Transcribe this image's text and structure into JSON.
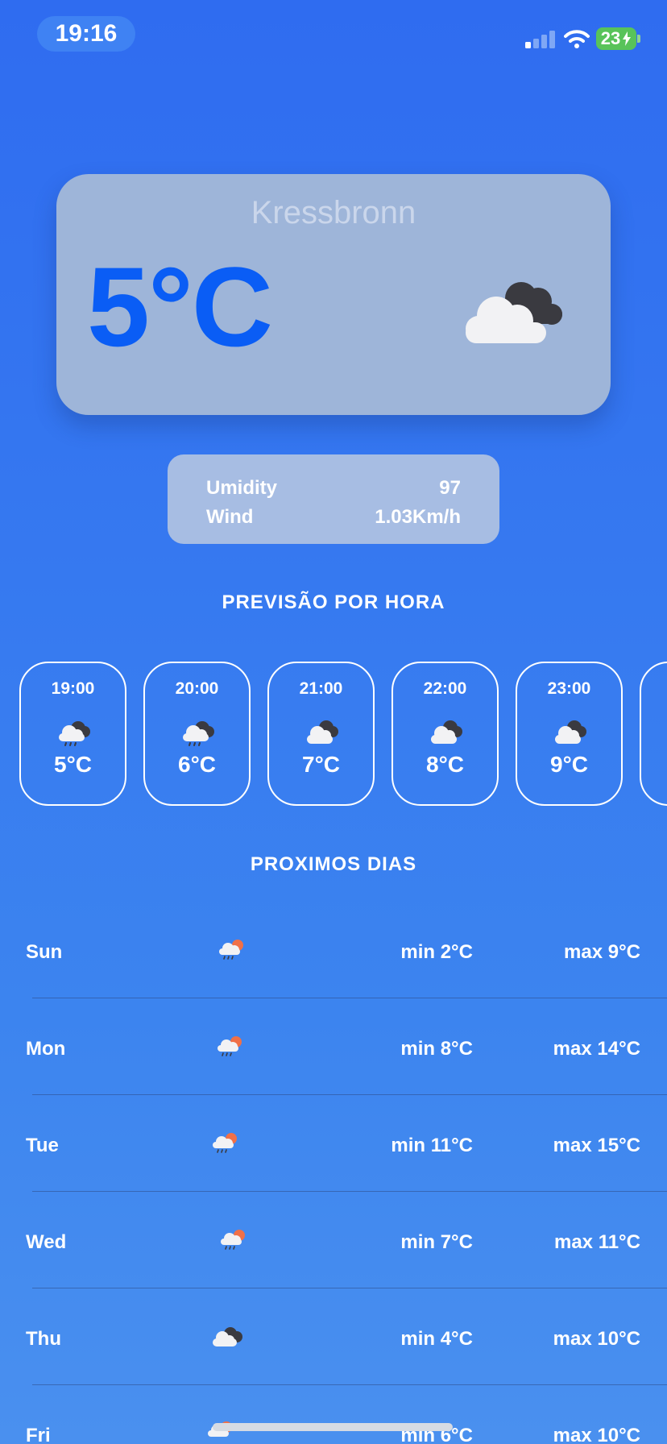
{
  "status_bar": {
    "time": "19:16",
    "battery": "23",
    "icons": [
      "signal-icon",
      "wifi-icon",
      "battery-charging-icon"
    ]
  },
  "current": {
    "city": "Kressbronn",
    "temperature": "5°C",
    "icon": "cloudy-icon"
  },
  "details": {
    "humidity_label": "Umidity",
    "humidity_value": "97",
    "wind_label": "Wind",
    "wind_value": "1.03Km/h"
  },
  "hourly": {
    "title": "PREVISÃO POR HORA",
    "items": [
      {
        "time": "19:00",
        "temp": "5°C",
        "icon": "rain-cloud-icon"
      },
      {
        "time": "20:00",
        "temp": "6°C",
        "icon": "rain-cloud-icon"
      },
      {
        "time": "21:00",
        "temp": "7°C",
        "icon": "cloudy-icon"
      },
      {
        "time": "22:00",
        "temp": "8°C",
        "icon": "cloudy-icon"
      },
      {
        "time": "23:00",
        "temp": "9°C",
        "icon": "cloudy-icon"
      }
    ]
  },
  "daily": {
    "title": "PROXIMOS DIAS",
    "items": [
      {
        "day": "Sun",
        "min": "min 2°C",
        "max": "max 9°C",
        "icon": "sun-rain-icon"
      },
      {
        "day": "Mon",
        "min": "min 8°C",
        "max": "max 14°C",
        "icon": "sun-rain-icon"
      },
      {
        "day": "Tue",
        "min": "min 11°C",
        "max": "max 15°C",
        "icon": "sun-rain-icon"
      },
      {
        "day": "Wed",
        "min": "min 7°C",
        "max": "max 11°C",
        "icon": "sun-rain-icon"
      },
      {
        "day": "Thu",
        "min": "min 4°C",
        "max": "max 10°C",
        "icon": "cloudy-icon"
      },
      {
        "day": "Fri",
        "min": "min 6°C",
        "max": "max 10°C",
        "icon": "sun-rain-icon"
      }
    ]
  },
  "colors": {
    "background": "#3679f0",
    "temperature": "#0a5df5",
    "card": "#9eb5d9",
    "battery": "#58c35a"
  }
}
